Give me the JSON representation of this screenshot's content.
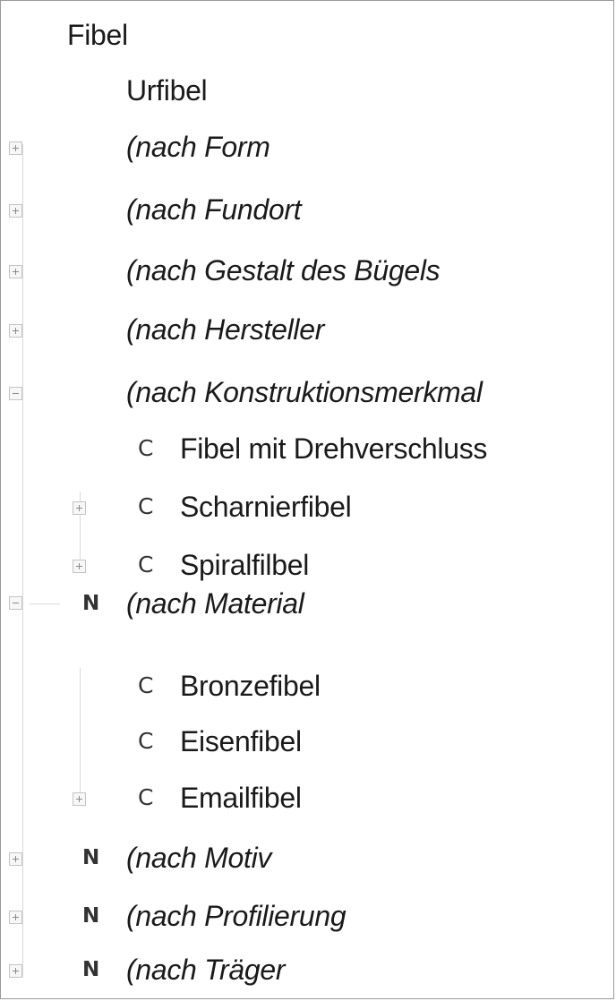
{
  "tree": {
    "root": {
      "label": "Fibel"
    },
    "urfibel": {
      "label": "Urfibel"
    },
    "nach_form": {
      "label": "(nach Form",
      "expanded": false
    },
    "nach_fundort": {
      "label": "(nach Fundort",
      "expanded": false
    },
    "nach_gestalt": {
      "label": "(nach Gestalt des Bügels",
      "expanded": false
    },
    "nach_hersteller": {
      "label": "(nach Hersteller",
      "expanded": false
    },
    "nach_konstruktion": {
      "label": "(nach Konstruktionsmerkmal",
      "expanded": true,
      "children": [
        {
          "icon": "C",
          "label": "Fibel mit Drehverschluss",
          "expandable": false
        },
        {
          "icon": "C",
          "label": "Scharnierfibel",
          "expandable": true,
          "expanded": false
        },
        {
          "icon": "C",
          "label": "Spiralfilbel",
          "expandable": true,
          "expanded": false
        }
      ]
    },
    "nach_material": {
      "icon": "N",
      "label": "(nach Material",
      "expanded": true,
      "children": [
        {
          "icon": "C",
          "label": "Bronzefibel",
          "expandable": false
        },
        {
          "icon": "C",
          "label": "Eisenfibel",
          "expandable": false
        },
        {
          "icon": "C",
          "label": "Emailfibel",
          "expandable": true,
          "expanded": false
        }
      ]
    },
    "nach_motiv": {
      "icon": "N",
      "label": "(nach Motiv",
      "expanded": false
    },
    "nach_profilierung": {
      "icon": "N",
      "label": "(nach Profilierung",
      "expanded": false
    },
    "nach_traeger": {
      "icon": "N",
      "label": "(nach Träger",
      "expanded": false
    }
  }
}
